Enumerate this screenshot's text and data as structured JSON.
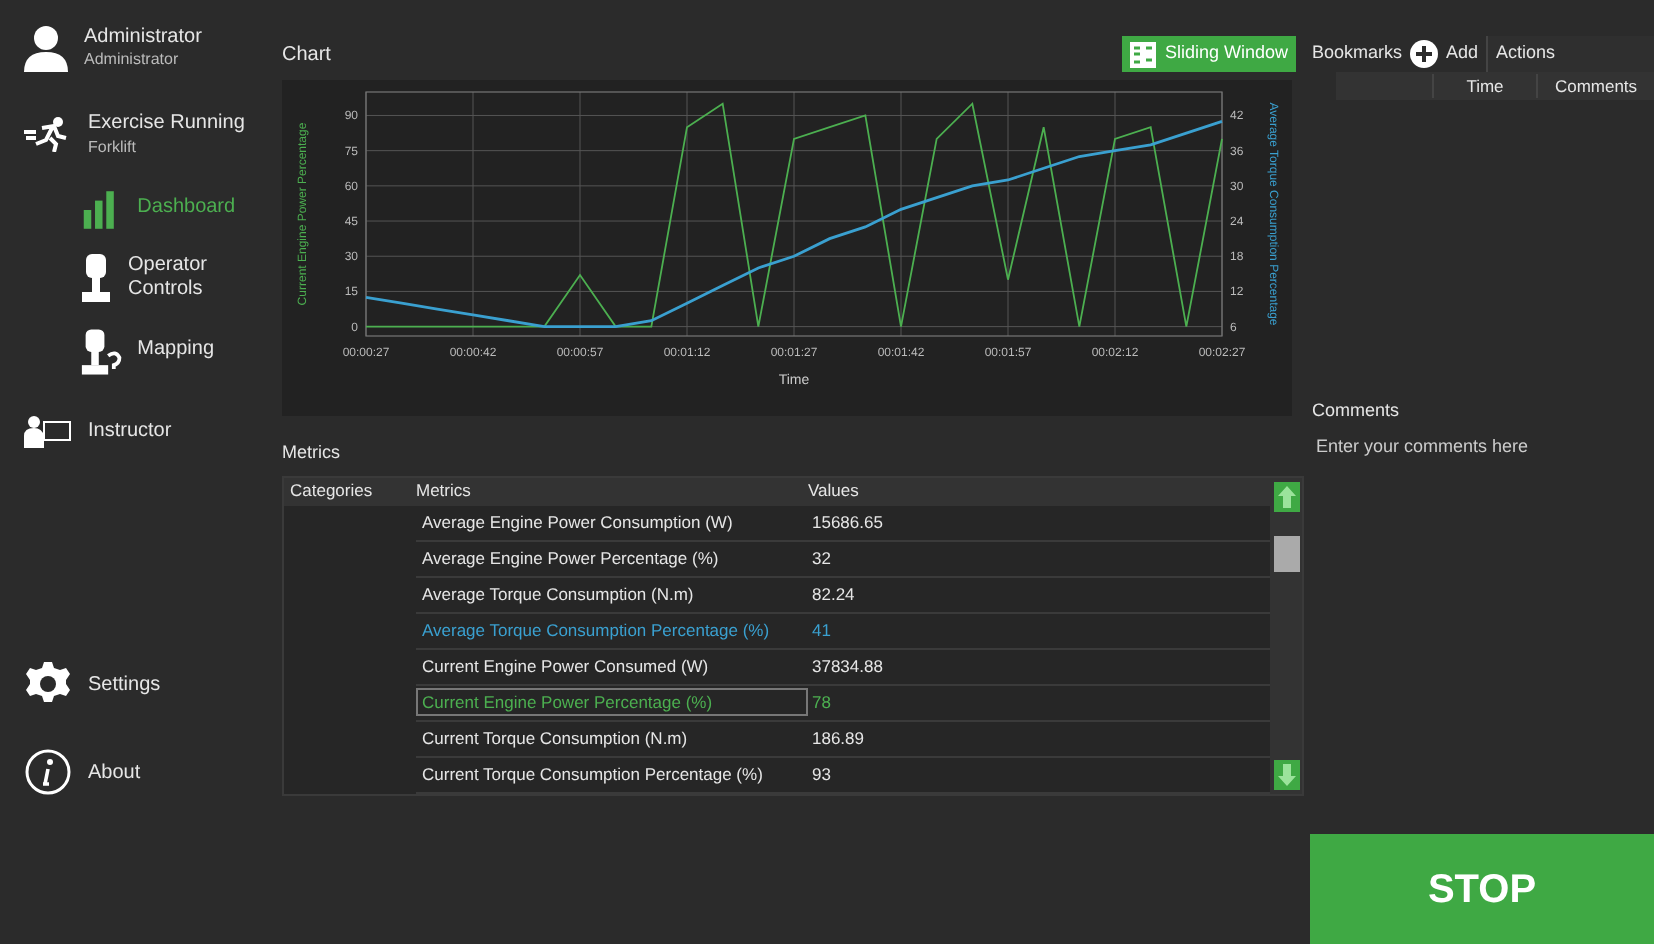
{
  "user": {
    "name": "Administrator",
    "role": "Administrator"
  },
  "exercise": {
    "title": "Exercise Running",
    "subtitle": "Forklift"
  },
  "nav": [
    {
      "kind": "dashboard",
      "label": "Dashboard",
      "selected": true
    },
    {
      "kind": "controls",
      "label": "Operator Controls",
      "selected": false
    },
    {
      "kind": "mapping",
      "label": "Mapping",
      "selected": false
    }
  ],
  "instructor": {
    "label": "Instructor"
  },
  "bottom_nav": [
    {
      "kind": "settings",
      "label": "Settings"
    },
    {
      "kind": "about",
      "label": "About"
    }
  ],
  "chart_panel": {
    "title": "Chart",
    "sliding_button": "Sliding Window",
    "chart_data": {
      "type": "line",
      "xlabel": "Time",
      "categories": [
        "00:00:27",
        null,
        null,
        "00:00:42",
        null,
        null,
        "00:00:57",
        null,
        null,
        "00:01:12",
        null,
        null,
        "00:01:27",
        null,
        null,
        "00:01:42",
        null,
        null,
        "00:01:57",
        null,
        null,
        "00:02:12",
        null,
        null,
        "00:02:27"
      ],
      "grid": true,
      "ylim": [
        -4,
        100
      ],
      "y2lim": [
        4.4,
        46
      ],
      "yticks": [
        0,
        15,
        30,
        45,
        60,
        75,
        90
      ],
      "y2ticks": [
        6,
        12,
        18,
        24,
        30,
        36,
        42
      ],
      "series": [
        {
          "name": "Current Engine Power Percentage",
          "color": "#4caf50",
          "values": [
            0,
            0,
            0,
            0,
            0,
            0,
            22,
            0,
            0,
            85,
            95,
            0,
            80,
            85,
            90,
            0,
            80,
            95,
            20,
            85,
            0,
            80,
            85,
            0,
            80
          ]
        },
        {
          "name": "Average Torque Consumption Percentage",
          "color": "#3aa0d0",
          "axis": "y2",
          "values": [
            11,
            10,
            9,
            8,
            7,
            6,
            6,
            6,
            7,
            10,
            13,
            16,
            18,
            21,
            23,
            26,
            28,
            30,
            31,
            33,
            35,
            36,
            37,
            39,
            41
          ]
        }
      ]
    }
  },
  "bookmarks": {
    "title": "Bookmarks",
    "add_button": "Add",
    "actions": "Actions",
    "columns": [
      "Time",
      "Comments"
    ]
  },
  "metrics": {
    "title": "Metrics",
    "columns": [
      "Categories",
      "Metrics",
      "Values"
    ],
    "rows": [
      {
        "metric": "Average Engine Power Consumption (W)",
        "value": "15686.65",
        "selected": false
      },
      {
        "metric": "Average Engine Power Percentage (%)",
        "value": "32",
        "selected": false
      },
      {
        "metric": "Average Torque Consumption (N.m)",
        "value": "82.24",
        "selected": false
      },
      {
        "metric": "Average Torque Consumption Percentage (%)",
        "value": "41",
        "selected": false,
        "color": "#3aa0d0"
      },
      {
        "metric": "Current Engine Power Consumed (W)",
        "value": "37834.88",
        "selected": false
      },
      {
        "metric": "Current Engine Power Percentage (%)",
        "value": "78",
        "selected": true,
        "color": "#4caf50"
      },
      {
        "metric": "Current Torque Consumption (N.m)",
        "value": "186.89",
        "selected": false
      },
      {
        "metric": "Current Torque Consumption Percentage (%)",
        "value": "93",
        "selected": false
      }
    ]
  },
  "comments": {
    "title": "Comments",
    "placeholder": "Enter your comments here"
  },
  "stop_button": "STOP"
}
